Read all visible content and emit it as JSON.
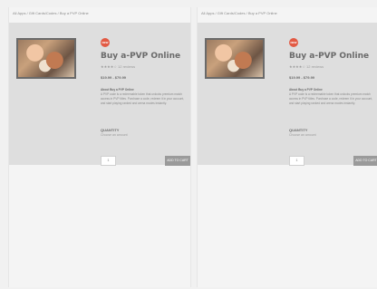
{
  "breadcrumb": [
    "All Apps",
    "Gift Cards/Codes",
    "Buy a PVP Online"
  ],
  "product": {
    "badge": "NEW",
    "title": "Buy a-PVP Online",
    "rating": "★★★★☆  12 reviews",
    "price": "$19.99 - $79.99",
    "description_heading": "About Buy a PVP Online",
    "description": "A PVP code is a redeemable token that unlocks premium match access in PVP titles. Purchase a code, redeem it in your account, and start playing ranked and arena modes instantly.",
    "qty_label": "QUANTITY",
    "qty_hint": "Choose an amount",
    "qty_value": "1",
    "add_button": "ADD TO CART"
  },
  "colors": {
    "badge": "#e25a44",
    "hero_bg": "#dedede",
    "button_bg": "#9a9a9a"
  }
}
